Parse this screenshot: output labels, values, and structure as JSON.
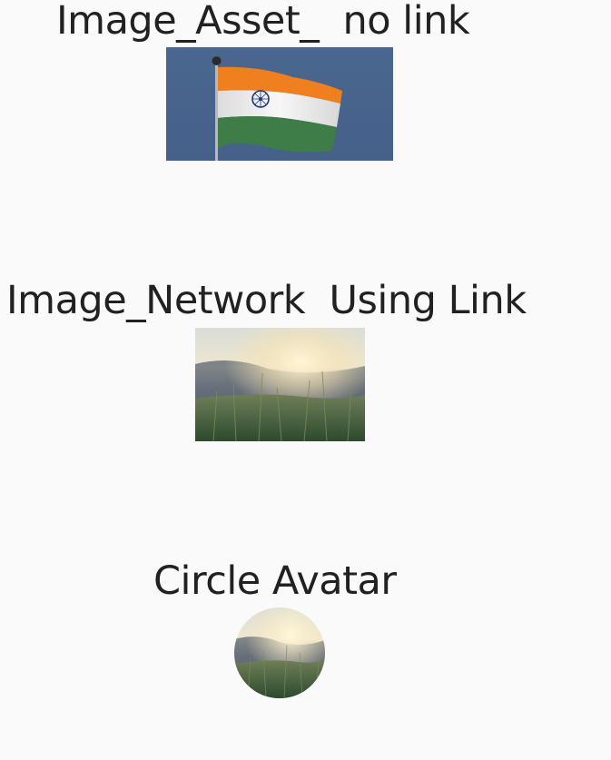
{
  "sections": {
    "asset": {
      "title": "Image_Asset_  no link",
      "image": "indian-flag-photo"
    },
    "network": {
      "title": "Image_Network  Using Link",
      "image": "grass-sunset-photo"
    },
    "avatar": {
      "title": "Circle Avatar",
      "image": "grass-sunset-photo"
    }
  },
  "colors": {
    "background": "#fafafa",
    "text": "#212121",
    "sky": "#4a6790",
    "saffron": "#f07f1f",
    "white": "#f2f2f2",
    "green": "#3f7d48",
    "chakra": "#1f3a7a"
  }
}
